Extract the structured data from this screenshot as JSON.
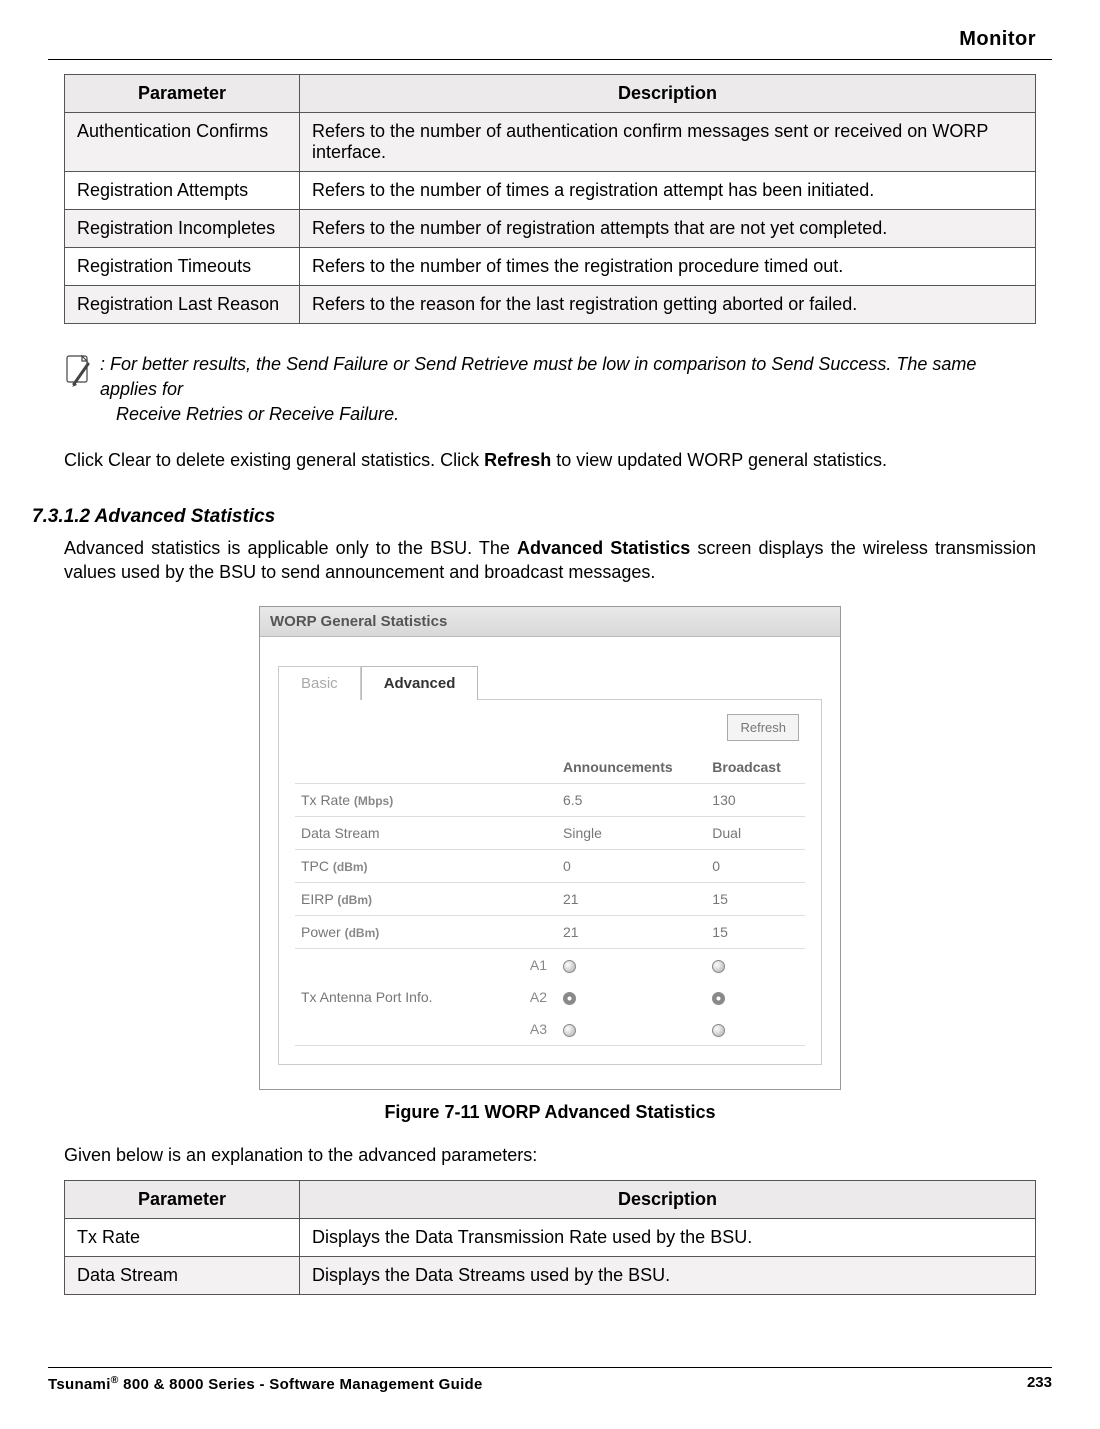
{
  "header": {
    "title": "Monitor"
  },
  "table1": {
    "headers": {
      "param": "Parameter",
      "desc": "Description"
    },
    "rows": [
      {
        "param": "Authentication Confirms",
        "desc": "Refers to the number of authentication confirm messages sent or received on WORP interface."
      },
      {
        "param": "Registration Attempts",
        "desc": "Refers to the number of times a registration attempt has been initiated."
      },
      {
        "param": "Registration Incompletes",
        "desc": "Refers to the number of registration attempts that are not yet completed."
      },
      {
        "param": "Registration Timeouts",
        "desc": "Refers to the number of times the registration procedure timed out."
      },
      {
        "param": "Registration Last Reason",
        "desc": "Refers to the reason for the last registration getting aborted or failed."
      }
    ]
  },
  "note": {
    "line1": ": For better results, the Send Failure or Send Retrieve must be low in comparison to Send Success. The same applies for",
    "line2": "Receive Retries or Receive Failure."
  },
  "para1": {
    "pre": "Click Clear to delete existing general statistics. Click ",
    "bold": "Refresh",
    "post": " to view updated WORP general statistics."
  },
  "subsection": {
    "number_title": "7.3.1.2 Advanced Statistics",
    "intro_pre": "Advanced statistics is applicable only to the BSU. The ",
    "intro_bold": "Advanced Statistics",
    "intro_post": " screen displays the wireless transmission values used by the BSU to send announcement and broadcast messages."
  },
  "figure": {
    "caption": "Figure 7-11 WORP Advanced Statistics",
    "screenshot": {
      "title": "WORP General Statistics",
      "tabs": {
        "basic": "Basic",
        "advanced": "Advanced"
      },
      "refresh_label": "Refresh",
      "col_headers": {
        "ann": "Announcements",
        "bcast": "Broadcast"
      },
      "rows": {
        "tx_rate": {
          "label": "Tx Rate",
          "unit": "(Mbps)",
          "ann": "6.5",
          "bcast": "130"
        },
        "data_stream": {
          "label": "Data Stream",
          "unit": "",
          "ann": "Single",
          "bcast": "Dual"
        },
        "tpc": {
          "label": "TPC",
          "unit": "(dBm)",
          "ann": "0",
          "bcast": "0"
        },
        "eirp": {
          "label": "EIRP",
          "unit": "(dBm)",
          "ann": "21",
          "bcast": "15"
        },
        "power": {
          "label": "Power",
          "unit": "(dBm)",
          "ann": "21",
          "bcast": "15"
        }
      },
      "antenna": {
        "label": "Tx Antenna Port Info.",
        "ports": [
          "A1",
          "A2",
          "A3"
        ]
      }
    }
  },
  "para2": "Given below is an explanation to the advanced parameters:",
  "table2": {
    "headers": {
      "param": "Parameter",
      "desc": "Description"
    },
    "rows": [
      {
        "param": "Tx Rate",
        "desc": "Displays the Data Transmission Rate used by the BSU."
      },
      {
        "param": "Data Stream",
        "desc": "Displays the Data Streams used by the BSU."
      }
    ]
  },
  "footer": {
    "left_pre": "Tsunami",
    "left_post": " 800 & 8000 Series - Software Management Guide",
    "page": "233"
  }
}
